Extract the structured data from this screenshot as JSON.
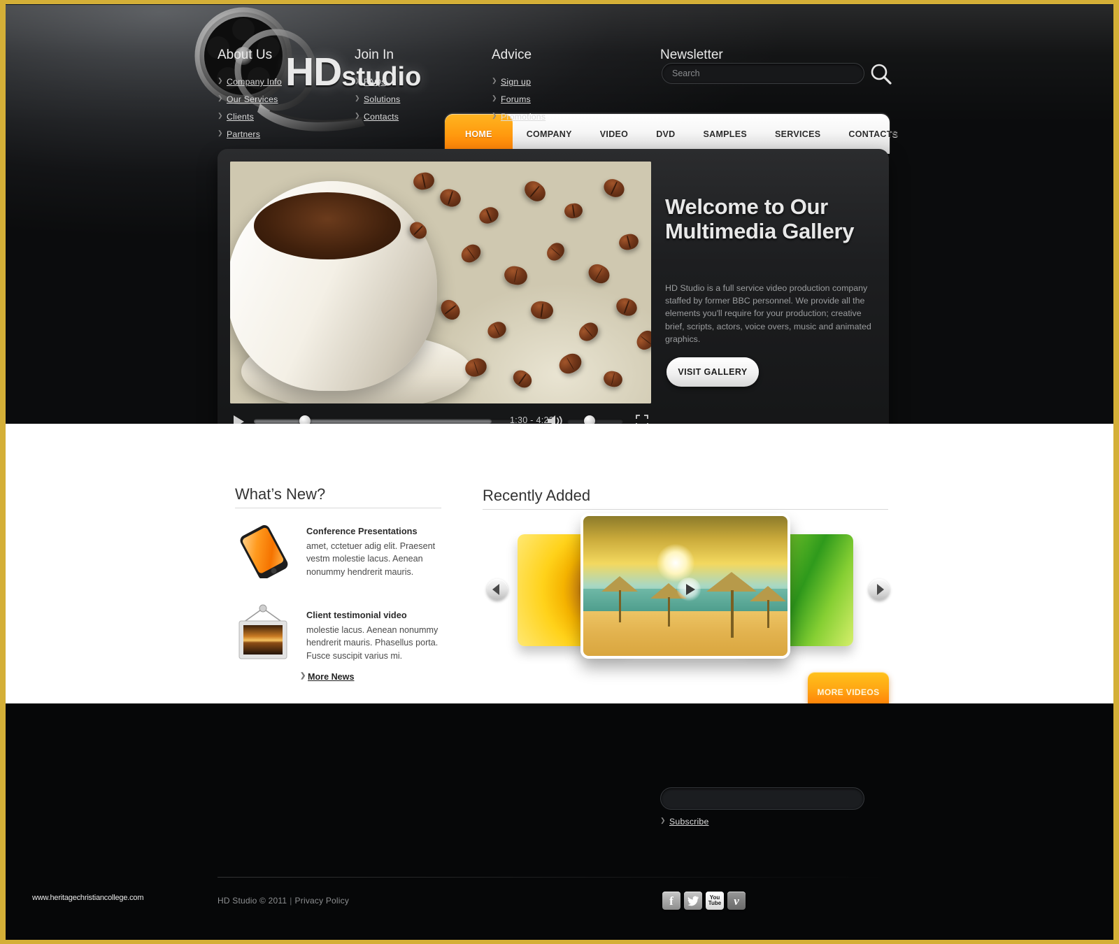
{
  "brand": {
    "name_bold": "HD",
    "name_light": "studio"
  },
  "search": {
    "placeholder": "Search",
    "value": "",
    "icon": "search-icon"
  },
  "nav": {
    "items": [
      {
        "label": "HOME",
        "active": true
      },
      {
        "label": "COMPANY",
        "active": false
      },
      {
        "label": "VIDEO",
        "active": false
      },
      {
        "label": "DVD",
        "active": false
      },
      {
        "label": "SAMPLES",
        "active": false
      },
      {
        "label": "SERVICES",
        "active": false
      },
      {
        "label": "CONTACTS",
        "active": false
      }
    ]
  },
  "player": {
    "heading": "Welcome to Our Multimedia Gallery",
    "body": "HD Studio is a full service video production company staffed by former BBC personnel. We provide all the elements you'll require for your production; creative brief, scripts, actors, voice overs, music and animated graphics.",
    "cta_label": "VISIT GALLERY",
    "time": "1:30 - 4:23",
    "icons": {
      "play": "play-icon",
      "volume": "volume-icon",
      "fullscreen": "fullscreen-icon"
    }
  },
  "whats_new": {
    "title": "What’s New?",
    "items": [
      {
        "icon": "mobile-phone-icon",
        "title": "Conference Presentations",
        "body": "amet, cctetuer adig elit. Praesent vestm molestie lacus. Aenean nonummy hendrerit mauris."
      },
      {
        "icon": "picture-frame-icon",
        "title": "Client testimonial video",
        "body": "molestie lacus. Aenean nonummy hendrerit mauris. Phasellus porta. Fusce suscipit varius mi."
      }
    ],
    "more_label": "More News"
  },
  "recently_added": {
    "title": "Recently Added",
    "slides": [
      {
        "name": "sunflower-thumbnail",
        "position": "left"
      },
      {
        "name": "beach-umbrellas-video",
        "position": "center"
      },
      {
        "name": "green-leaves-thumbnail",
        "position": "right"
      }
    ],
    "prev_icon": "chevron-left-icon",
    "next_icon": "chevron-right-icon",
    "play_icon": "play-icon",
    "more_label": "MORE VIDEOS"
  },
  "footer": {
    "columns": [
      {
        "head": "About Us",
        "links": [
          "Company Info",
          "Our Services",
          "Clients",
          "Partners"
        ]
      },
      {
        "head": "Join In",
        "links": [
          "FAQs",
          "Solutions",
          "Contacts"
        ]
      },
      {
        "head": "Advice",
        "links": [
          "Sign up",
          "Forums",
          "Promotions"
        ]
      }
    ],
    "newsletter": {
      "head": "Newsletter",
      "placeholder": "",
      "value": "",
      "subscribe_label": "Subscribe"
    },
    "copyright": "HD Studio © 2011",
    "separator": "|",
    "privacy_label": "Privacy Policy",
    "watermark": "www.heritagechristiancollege.com",
    "social": [
      {
        "name": "facebook-icon",
        "glyph": "f"
      },
      {
        "name": "twitter-icon",
        "glyph": "t"
      },
      {
        "name": "youtube-icon",
        "glyph": "You Tube"
      },
      {
        "name": "vimeo-icon",
        "glyph": "v"
      }
    ]
  },
  "colors": {
    "accent": "#ff8a0a",
    "border": "#d4af37",
    "dark": "#060708"
  }
}
